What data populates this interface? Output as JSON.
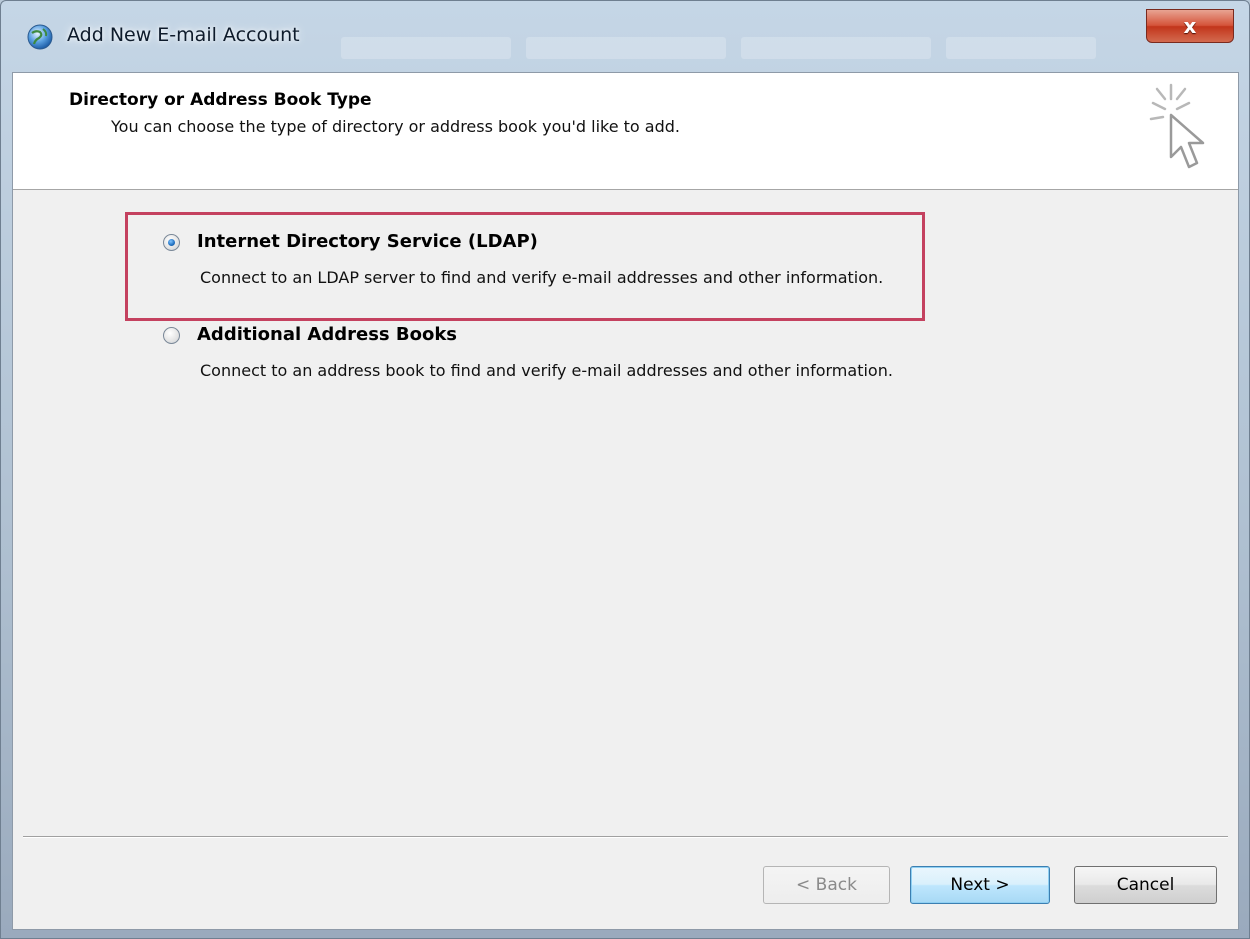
{
  "window": {
    "title": "Add New E-mail Account",
    "close_glyph": "x"
  },
  "header": {
    "title": "Directory or Address Book Type",
    "subtitle": "You can choose the type of directory or address book you'd like to add.",
    "icon": "wizard-cursor-icon"
  },
  "options": [
    {
      "label": "Internet Directory Service (LDAP)",
      "description": "Connect to an LDAP server to find and verify e-mail addresses and other information.",
      "selected": true
    },
    {
      "label": "Additional Address Books",
      "description": "Connect to an address book to find and verify e-mail addresses and other information.",
      "selected": false
    }
  ],
  "buttons": {
    "back": "< Back",
    "next": "Next >",
    "cancel": "Cancel"
  },
  "colors": {
    "highlight_border": "#c4415f",
    "close_button": "#c2351b",
    "default_button_border": "#3c7fb1"
  }
}
